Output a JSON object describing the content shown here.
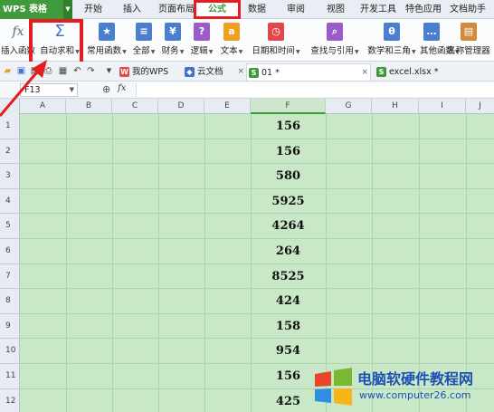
{
  "app": {
    "name": "WPS 表格"
  },
  "menu_tabs": [
    "开始",
    "插入",
    "页面布局",
    "公式",
    "数据",
    "审阅",
    "视图",
    "开发工具",
    "特色应用",
    "文档助手"
  ],
  "active_tab": "公式",
  "ribbon": {
    "insert_function": "插入函数",
    "autosum": "自动求和",
    "common": "常用函数",
    "all": "全部",
    "finance": "财务",
    "logic": "逻辑",
    "text": "文本",
    "datetime": "日期和时间",
    "lookup": "查找与引用",
    "math": "数学和三角",
    "other": "其他函数",
    "name_manager": "名称管理器"
  },
  "doc_tabs": [
    {
      "label": "我的WPS"
    },
    {
      "label": "云文档"
    },
    {
      "label": "01 *"
    },
    {
      "label": "excel.xlsx *"
    }
  ],
  "formula_bar": {
    "cell_ref": "F13",
    "fx": "fx",
    "value": ""
  },
  "columns": [
    "A",
    "B",
    "C",
    "D",
    "E",
    "F",
    "G",
    "H",
    "I",
    "J"
  ],
  "selected_column": "F",
  "rows": [
    "1",
    "2",
    "3",
    "4",
    "5",
    "6",
    "7",
    "8",
    "9",
    "10",
    "11",
    "12"
  ],
  "column_f_values": [
    "156",
    "156",
    "580",
    "5925",
    "4264",
    "264",
    "8525",
    "424",
    "158",
    "954",
    "156",
    "425"
  ],
  "colors": {
    "brand": "#3f9a3c",
    "highlight": "#e21e1e",
    "sheet_bg": "#c9e8c7"
  },
  "watermark": {
    "title": "电脑软硬件教程网",
    "url": "www.computer26.com"
  }
}
